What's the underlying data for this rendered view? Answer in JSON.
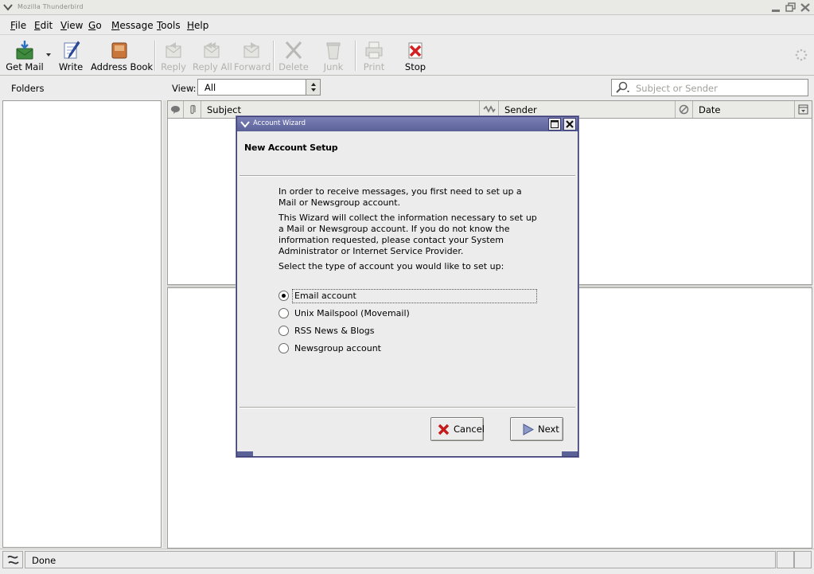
{
  "window": {
    "title": "Mozilla Thunderbird"
  },
  "menubar": [
    {
      "label": "File",
      "ul": "F",
      "rest": "ile"
    },
    {
      "label": "Edit",
      "ul": "E",
      "rest": "dit"
    },
    {
      "label": "View",
      "ul": "V",
      "rest": "iew"
    },
    {
      "label": "Go",
      "ul": "G",
      "rest": "o"
    },
    {
      "label": "Message",
      "ul": "M",
      "rest": "essage"
    },
    {
      "label": "Tools",
      "ul": "T",
      "rest": "ools"
    },
    {
      "label": "Help",
      "ul": "H",
      "rest": "elp"
    }
  ],
  "toolbar": {
    "get_mail": "Get Mail",
    "write": "Write",
    "address_book": "Address Book",
    "reply": "Reply",
    "reply_all": "Reply All",
    "forward": "Forward",
    "delete": "Delete",
    "junk": "Junk",
    "print": "Print",
    "stop": "Stop"
  },
  "header": {
    "folders": "Folders",
    "view_label": "View:",
    "view_value": "All",
    "search_placeholder": "Subject or Sender"
  },
  "thread_columns": {
    "subject": "Subject",
    "sender": "Sender",
    "date": "Date"
  },
  "status": {
    "text": "Done"
  },
  "dialog": {
    "title": "Account Wizard",
    "heading": "New Account Setup",
    "para1": "In order to receive messages, you first need to set up a Mail or Newsgroup account.",
    "para2": "This Wizard will collect the information necessary to set up a Mail or Newsgroup account. If you do not know the information requested, please contact your System Administrator or Internet Service Provider.",
    "para3": "Select the type of account you would like to set up:",
    "options": [
      {
        "label": "Email account",
        "selected": true
      },
      {
        "label": "Unix Mailspool (Movemail)",
        "selected": false
      },
      {
        "label": "RSS News & Blogs",
        "selected": false
      },
      {
        "label": "Newsgroup account",
        "selected": false
      }
    ],
    "cancel": "Cancel",
    "next": "Next"
  },
  "colors": {
    "dialog_title_bg": "#6a70a8",
    "window_bg": "#ececec",
    "stop_red": "#d42020"
  }
}
